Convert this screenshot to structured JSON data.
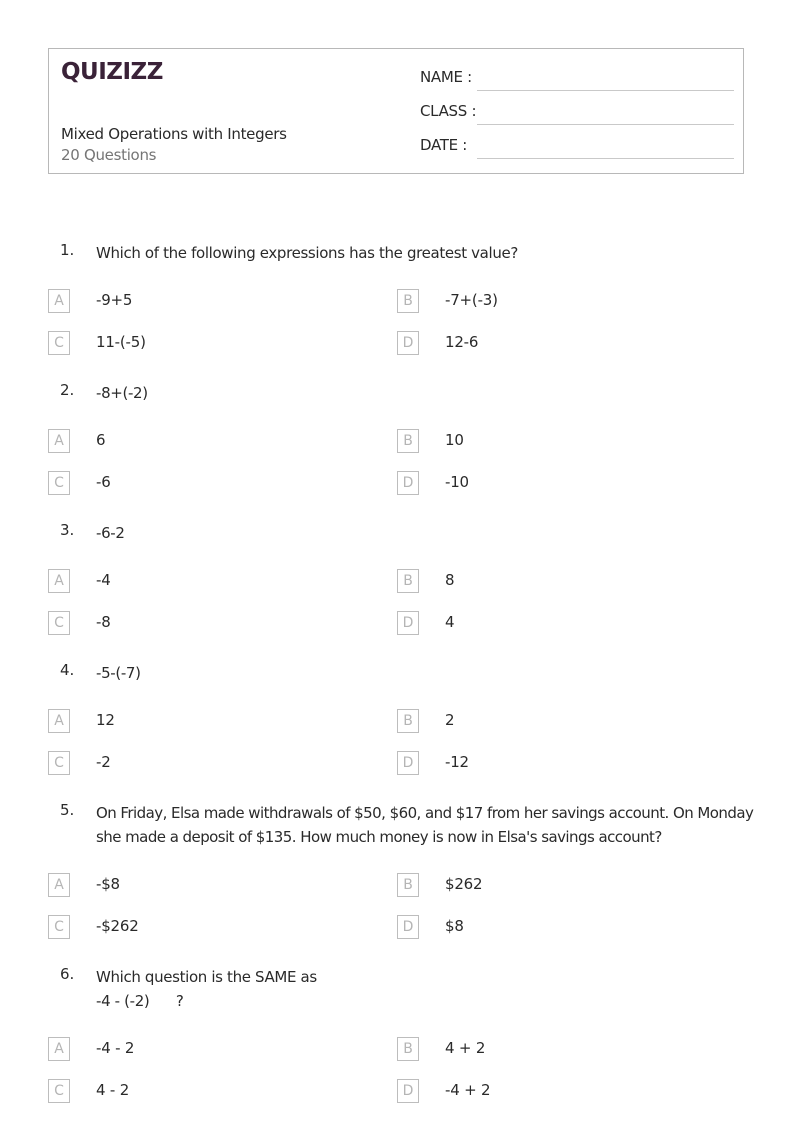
{
  "header": {
    "logo": "QUIZIZZ",
    "title": "Mixed Operations with Integers",
    "question_count": "20 Questions",
    "fields": [
      {
        "label": "NAME :",
        "value": ""
      },
      {
        "label": "CLASS :",
        "value": ""
      },
      {
        "label": "DATE  :",
        "value": ""
      }
    ]
  },
  "questions": [
    {
      "number": "1.",
      "text": "Which of the following expressions has the greatest value?",
      "options": [
        {
          "letter": "A",
          "text": "-9+5"
        },
        {
          "letter": "B",
          "text": "-7+(-3)"
        },
        {
          "letter": "C",
          "text": "11-(-5)"
        },
        {
          "letter": "D",
          "text": "12-6"
        }
      ]
    },
    {
      "number": "2.",
      "text": "-8+(-2)",
      "options": [
        {
          "letter": "A",
          "text": "6"
        },
        {
          "letter": "B",
          "text": "10"
        },
        {
          "letter": "C",
          "text": "-6"
        },
        {
          "letter": "D",
          "text": "-10"
        }
      ]
    },
    {
      "number": "3.",
      "text": "-6-2",
      "options": [
        {
          "letter": "A",
          "text": "-4"
        },
        {
          "letter": "B",
          "text": "8"
        },
        {
          "letter": "C",
          "text": "-8"
        },
        {
          "letter": "D",
          "text": "4"
        }
      ]
    },
    {
      "number": "4.",
      "text": "-5-(-7)",
      "options": [
        {
          "letter": "A",
          "text": "12"
        },
        {
          "letter": "B",
          "text": "2"
        },
        {
          "letter": "C",
          "text": "-2"
        },
        {
          "letter": "D",
          "text": "-12"
        }
      ]
    },
    {
      "number": "5.",
      "text": "On Friday, Elsa made withdrawals of $50, $60, and $17 from her savings account. On Monday she made a deposit of $135. How much money is now in Elsa's savings account?",
      "options": [
        {
          "letter": "A",
          "text": "-$8"
        },
        {
          "letter": "B",
          "text": "$262"
        },
        {
          "letter": "C",
          "text": "-$262"
        },
        {
          "letter": "D",
          "text": "$8"
        }
      ]
    },
    {
      "number": "6.",
      "text": "Which question is the SAME as\n-4 - (-2)      ?",
      "options": [
        {
          "letter": "A",
          "text": "-4 - 2"
        },
        {
          "letter": "B",
          "text": "4 + 2"
        },
        {
          "letter": "C",
          "text": "4 - 2"
        },
        {
          "letter": "D",
          "text": "-4 + 2"
        }
      ]
    }
  ]
}
